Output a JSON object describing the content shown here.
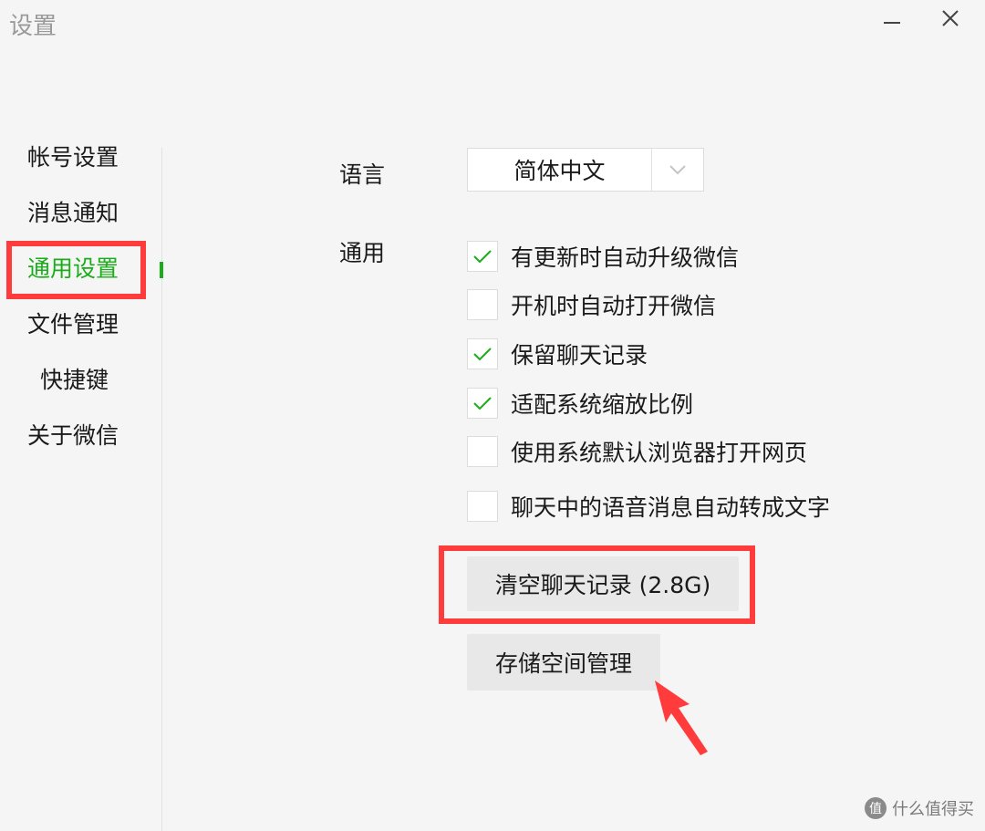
{
  "window": {
    "title": "设置"
  },
  "sidebar": {
    "items": [
      {
        "label": "帐号设置"
      },
      {
        "label": "消息通知"
      },
      {
        "label": "通用设置",
        "active": true
      },
      {
        "label": "文件管理"
      },
      {
        "label": "快捷键"
      },
      {
        "label": "关于微信"
      }
    ]
  },
  "language": {
    "label": "语言",
    "value": "简体中文"
  },
  "general": {
    "label": "通用",
    "options": [
      {
        "label": "有更新时自动升级微信",
        "checked": true
      },
      {
        "label": "开机时自动打开微信",
        "checked": false
      },
      {
        "label": "保留聊天记录",
        "checked": true
      },
      {
        "label": "适配系统缩放比例",
        "checked": true
      },
      {
        "label": "使用系统默认浏览器打开网页",
        "checked": false
      },
      {
        "label": "聊天中的语音消息自动转成文字",
        "checked": false
      }
    ]
  },
  "actions": {
    "clear_history": "清空聊天记录 (2.8G)",
    "storage_manage": "存储空间管理"
  },
  "watermark": {
    "text": "什么值得买",
    "badge": "值"
  },
  "colors": {
    "accent": "#1aad19",
    "highlight": "#ff3b3b"
  }
}
